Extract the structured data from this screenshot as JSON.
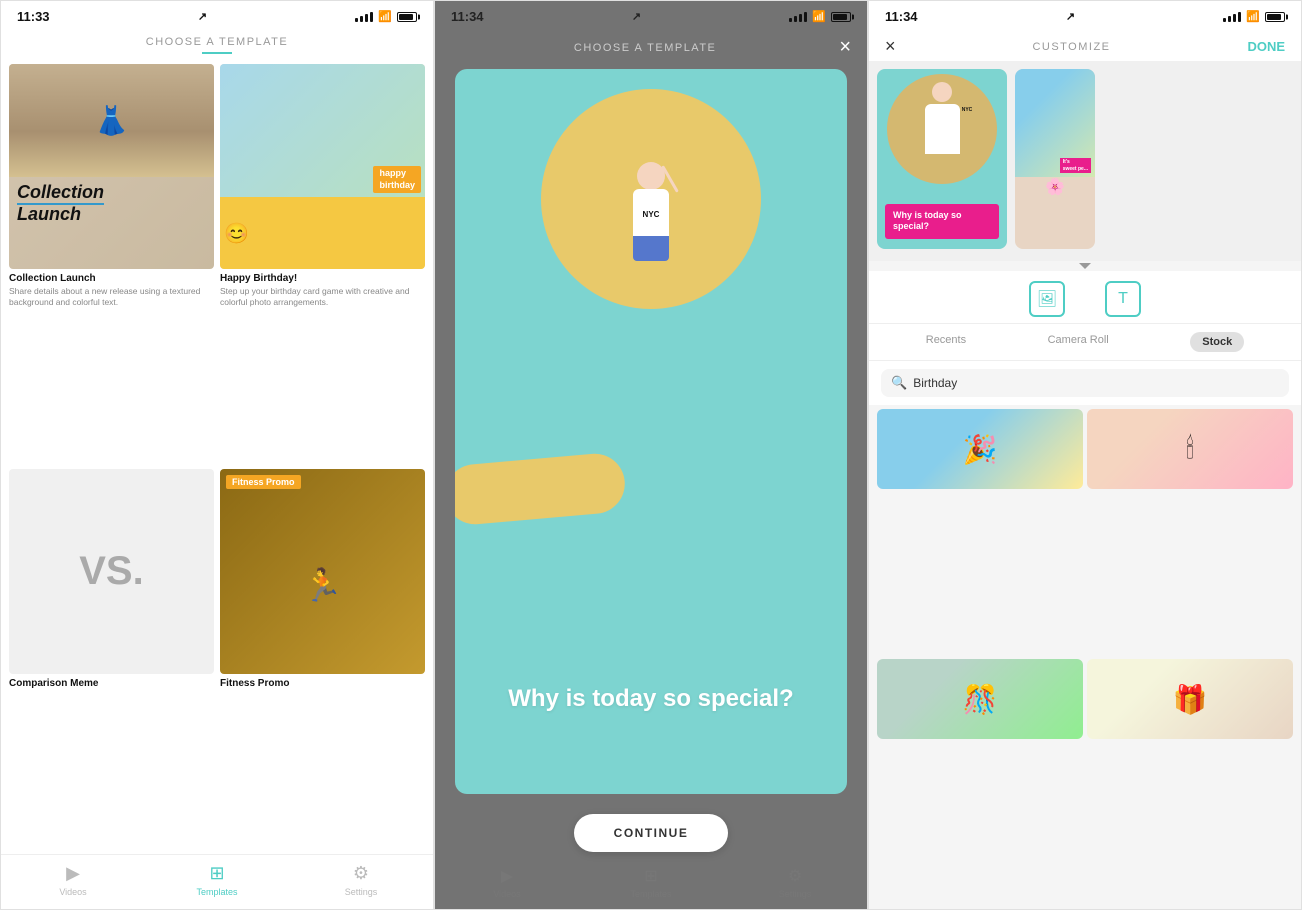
{
  "screen1": {
    "status": {
      "time": "11:33",
      "location": "↗"
    },
    "header": {
      "title": "CHOOSE A TEMPLATE",
      "underline": true
    },
    "templates": [
      {
        "id": "collection-launch",
        "thumb_type": "collection",
        "name": "Collection Launch",
        "desc": "Share details about a new release using a textured background and colorful text."
      },
      {
        "id": "happy-birthday",
        "thumb_type": "birthday",
        "name": "Happy Birthday!",
        "desc": "Step up your birthday card game with creative and colorful photo arrangements."
      },
      {
        "id": "vs",
        "thumb_type": "vs",
        "name": "Comparison Meme",
        "desc": ""
      },
      {
        "id": "fitness-promo",
        "thumb_type": "fitness",
        "name": "Fitness Promo",
        "desc": ""
      }
    ],
    "nav": {
      "items": [
        {
          "id": "videos",
          "label": "Videos",
          "active": false
        },
        {
          "id": "templates",
          "label": "Templates",
          "active": true
        },
        {
          "id": "settings",
          "label": "Settings",
          "active": false
        }
      ]
    }
  },
  "screen2": {
    "status": {
      "time": "11:34",
      "location": "↗"
    },
    "header": {
      "title": "CHOOSE A TEMPLATE",
      "close_label": "×"
    },
    "modal": {
      "question": "Why is today so special?",
      "person_text": "NYC"
    },
    "continue_button": "CONTINUE",
    "nav": {
      "items": [
        {
          "id": "videos",
          "label": "Videos"
        },
        {
          "id": "templates",
          "label": "Templates"
        },
        {
          "id": "settings",
          "label": "Settings"
        }
      ]
    }
  },
  "screen3": {
    "status": {
      "time": "11:34",
      "location": "↗"
    },
    "header": {
      "close_label": "×",
      "title": "CUSTOMIZE",
      "done_label": "DONE"
    },
    "preview": {
      "card1_text": "Why is today so special?",
      "card2_badge": "It's sweet pe..."
    },
    "tools": [
      {
        "id": "image-tool",
        "icon": "⊞"
      },
      {
        "id": "text-tool",
        "icon": "T"
      }
    ],
    "tabs": [
      {
        "id": "recents",
        "label": "Recents",
        "active": false
      },
      {
        "id": "camera-roll",
        "label": "Camera Roll",
        "active": false
      },
      {
        "id": "stock",
        "label": "Stock",
        "active": true
      }
    ],
    "search": {
      "placeholder": "Birthday",
      "value": "Birthday"
    },
    "stock_images": [
      {
        "id": "stock-1",
        "type": "child-birthday"
      },
      {
        "id": "stock-2",
        "type": "candles"
      },
      {
        "id": "stock-3",
        "type": "party"
      },
      {
        "id": "stock-4",
        "type": "celebration"
      }
    ]
  }
}
